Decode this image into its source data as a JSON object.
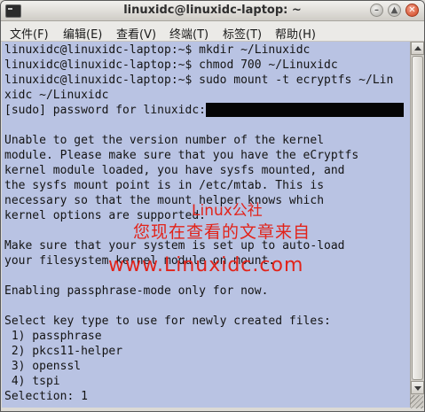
{
  "window": {
    "title": "linuxidc@linuxidc-laptop: ~",
    "controls": {
      "minimize": "–",
      "maximize": "▲",
      "close": "✕"
    }
  },
  "menu": {
    "items": [
      "文件(F)",
      "编辑(E)",
      "查看(V)",
      "终端(T)",
      "标签(T)",
      "帮助(H)"
    ]
  },
  "terminal": {
    "lines": [
      "linuxidc@linuxidc-laptop:~$ mkdir ~/Linuxidc",
      "linuxidc@linuxidc-laptop:~$ chmod 700 ~/Linuxidc",
      "linuxidc@linuxidc-laptop:~$ sudo mount -t ecryptfs ~/Lin",
      "xidc ~/Linuxidc",
      "[sudo] password for linuxidc:",
      "",
      "Unable to get the version number of the kernel",
      "module. Please make sure that you have the eCryptfs",
      "kernel module loaded, you have sysfs mounted, and",
      "the sysfs mount point is in /etc/mtab. This is",
      "necessary so that the mount helper knows which",
      "kernel options are supported.",
      "",
      "Make sure that your system is set up to auto-load",
      "your filesystem kernel module on mount.",
      "",
      "Enabling passphrase-mode only for now.",
      "",
      "Select key type to use for newly created files:",
      " 1) passphrase",
      " 2) pkcs11-helper",
      " 3) openssl",
      " 4) tspi",
      "Selection: 1"
    ],
    "colors": {
      "background": "#b9c3e3",
      "foreground": "#141414"
    }
  },
  "watermark": {
    "line1": "Linux公社",
    "line2": "您现在查看的文章来自",
    "line3": "www.Linuxidc.com",
    "color": "#e2231a"
  }
}
